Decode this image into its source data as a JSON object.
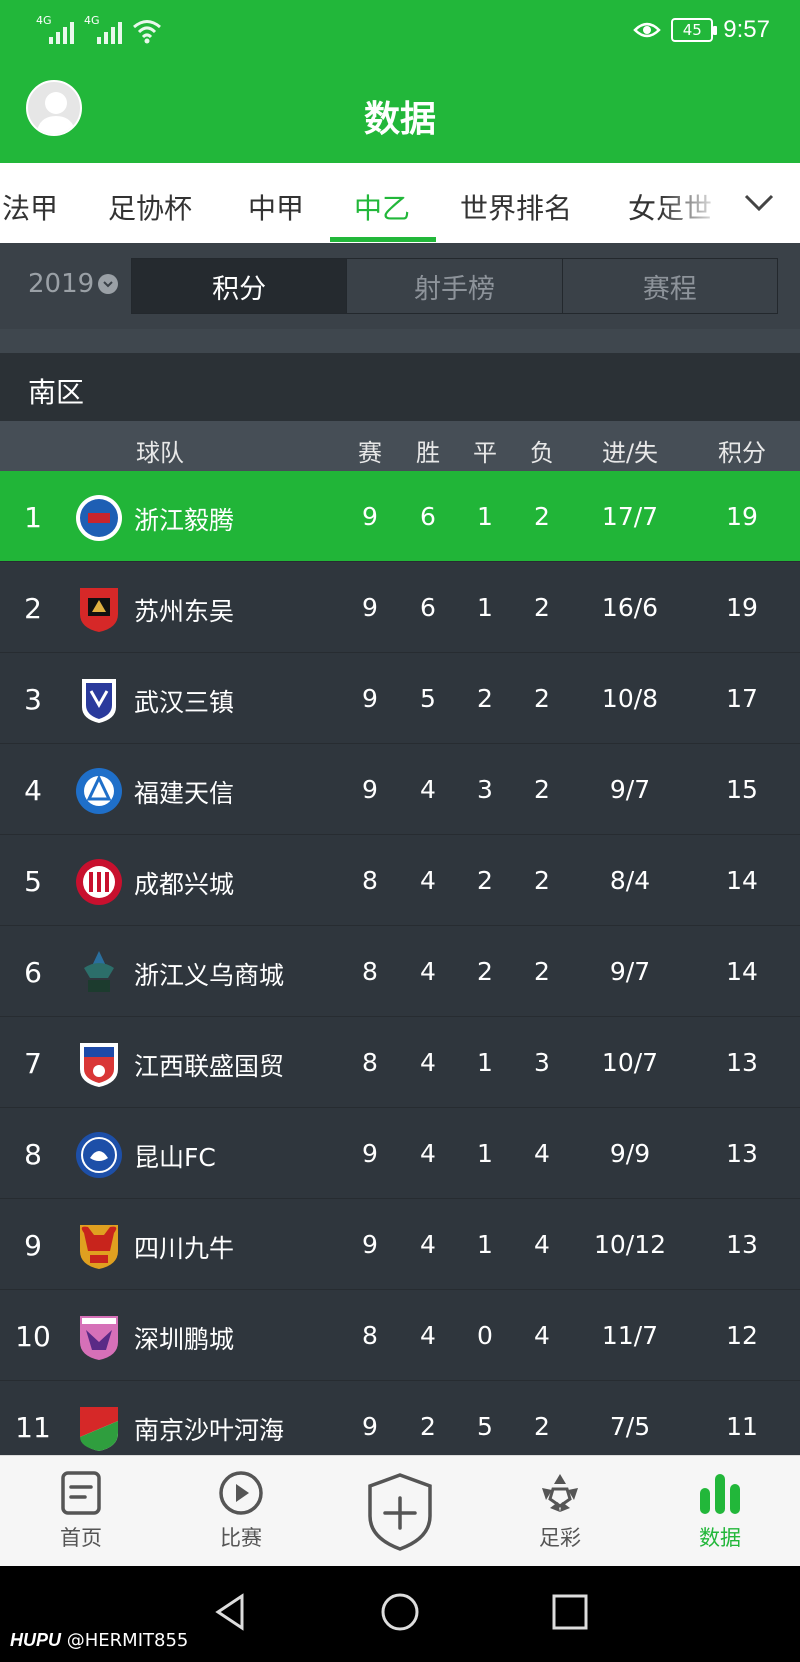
{
  "status": {
    "network1": "4G",
    "network2": "4G",
    "battery": "45",
    "time": "9:57"
  },
  "header": {
    "title": "数据"
  },
  "league_tabs": [
    "法甲",
    "足协杯",
    "中甲",
    "中乙",
    "世界排名",
    "女足世"
  ],
  "active_league": "中乙",
  "season": "2019",
  "segments": [
    "积分",
    "射手榜",
    "赛程"
  ],
  "region": "南区",
  "table": {
    "headers": {
      "team": "球队",
      "played": "赛",
      "won": "胜",
      "drawn": "平",
      "lost": "负",
      "goals": "进/失",
      "points": "积分"
    },
    "rows": [
      {
        "rank": "1",
        "team": "浙江毅腾",
        "played": "9",
        "won": "6",
        "drawn": "1",
        "lost": "2",
        "goals": "17/7",
        "points": "19",
        "logo_color": "#1e5fb4"
      },
      {
        "rank": "2",
        "team": "苏州东吴",
        "played": "9",
        "won": "6",
        "drawn": "1",
        "lost": "2",
        "goals": "16/6",
        "points": "19",
        "logo_color": "#d62828"
      },
      {
        "rank": "3",
        "team": "武汉三镇",
        "played": "9",
        "won": "5",
        "drawn": "2",
        "lost": "2",
        "goals": "10/8",
        "points": "17",
        "logo_color": "#2a3a9c"
      },
      {
        "rank": "4",
        "team": "福建天信",
        "played": "9",
        "won": "4",
        "drawn": "3",
        "lost": "2",
        "goals": "9/7",
        "points": "15",
        "logo_color": "#1f6fc9"
      },
      {
        "rank": "5",
        "team": "成都兴城",
        "played": "8",
        "won": "4",
        "drawn": "2",
        "lost": "2",
        "goals": "8/4",
        "points": "14",
        "logo_color": "#c8102e"
      },
      {
        "rank": "6",
        "team": "浙江义乌商城",
        "played": "8",
        "won": "4",
        "drawn": "2",
        "lost": "2",
        "goals": "9/7",
        "points": "14",
        "logo_color": "#2c6e6a"
      },
      {
        "rank": "7",
        "team": "江西联盛国贸",
        "played": "8",
        "won": "4",
        "drawn": "1",
        "lost": "3",
        "goals": "10/7",
        "points": "13",
        "logo_color": "#d93636"
      },
      {
        "rank": "8",
        "team": "昆山FC",
        "played": "9",
        "won": "4",
        "drawn": "1",
        "lost": "4",
        "goals": "9/9",
        "points": "13",
        "logo_color": "#1d4fa8"
      },
      {
        "rank": "9",
        "team": "四川九牛",
        "played": "9",
        "won": "4",
        "drawn": "1",
        "lost": "4",
        "goals": "10/12",
        "points": "13",
        "logo_color": "#e0a020"
      },
      {
        "rank": "10",
        "team": "深圳鹏城",
        "played": "8",
        "won": "4",
        "drawn": "0",
        "lost": "4",
        "goals": "11/7",
        "points": "12",
        "logo_color": "#d670b8"
      },
      {
        "rank": "11",
        "team": "南京沙叶河海",
        "played": "9",
        "won": "2",
        "drawn": "5",
        "lost": "2",
        "goals": "7/5",
        "points": "11",
        "logo_color": "#2f9e3e"
      }
    ]
  },
  "bottom_nav": [
    "首页",
    "比赛",
    "足彩",
    "数据"
  ],
  "watermark": {
    "brand": "HUPU",
    "handle": "@HERMIT855"
  },
  "colors": {
    "accent": "#22b73a",
    "row_bg": "#2f363d",
    "header_bg": "#464e56"
  }
}
